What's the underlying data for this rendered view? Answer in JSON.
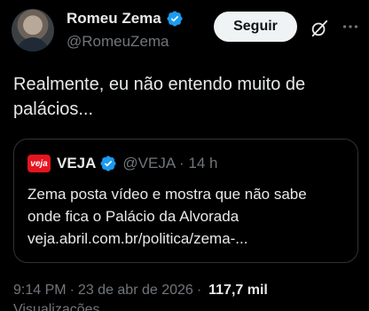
{
  "author": {
    "display_name": "Romeu Zema",
    "handle": "@RomeuZema",
    "avatar_icon": "profile-photo"
  },
  "actions": {
    "follow_label": "Seguir",
    "grok_icon": "grok-icon",
    "more_icon": "more-horizontal-icon"
  },
  "tweet": {
    "text": "Realmente, eu não entendo muito de palácios..."
  },
  "quote": {
    "logo_text": "veja",
    "name": "VEJA",
    "handle_time": "@VEJA · 14 h",
    "text_line1": "Zema posta vídeo e mostra que não sabe",
    "text_line2": "onde fica o Palácio da Alvorada",
    "text_line3": "veja.abril.com.br/politica/zema-..."
  },
  "meta": {
    "time": "9:14 PM",
    "dot1": "·",
    "date": "23 de abr de 2026",
    "dot2": "·",
    "views_count": "117,7 mil",
    "views_label": "Visualizações"
  },
  "colors": {
    "background": "#000000",
    "verified": "#1d9bf0",
    "veja_red": "#e4151f"
  }
}
